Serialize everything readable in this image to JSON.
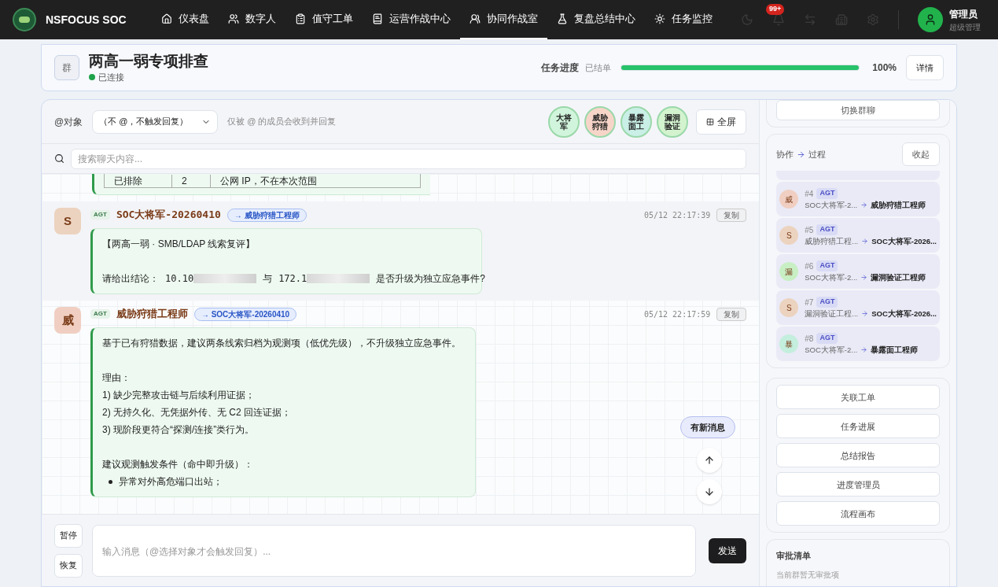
{
  "brand": "NSFOCUS SOC",
  "nav": [
    {
      "label": "仪表盘",
      "selected": false
    },
    {
      "label": "数字人",
      "selected": false
    },
    {
      "label": "值守工单",
      "selected": false
    },
    {
      "label": "运营作战中心",
      "selected": false
    },
    {
      "label": "协同作战室",
      "selected": true
    },
    {
      "label": "复盘总结中心",
      "selected": false
    },
    {
      "label": "任务监控",
      "selected": false
    }
  ],
  "notifications_badge": "99+",
  "user": {
    "name": "管理员",
    "role": "超级管理"
  },
  "room": {
    "avatar": "群",
    "title": "两高一弱专项排查",
    "status": "已连接",
    "connected": true,
    "progress_label": "任务进度",
    "progress_state": "已结单",
    "level": 1,
    "percent": "100%",
    "details_button": "详情"
  },
  "mention": {
    "label": "@对象",
    "value": "（不 @，不触发回复）",
    "hint": "仅被 @ 的成员会收到并回复"
  },
  "members": [
    {
      "label": "大将军",
      "color": "#d1f5dc"
    },
    {
      "label": "威胁狩猎",
      "color": "#f6d5c8"
    },
    {
      "label": "暴露面工",
      "color": "#c9efe6"
    },
    {
      "label": "漏洞验证",
      "color": "#d3f3cf"
    }
  ],
  "fullscreen_button": "全屏",
  "search": {
    "placeholder": "搜索聊天内容..."
  },
  "table_row": [
    "已排除",
    "2",
    "公网 IP，不在本次范围"
  ],
  "messages": [
    {
      "avatar": "S",
      "color": "#ecd3bf",
      "tag": "AGT",
      "sender": "SOC大将军-20260410",
      "target": "→ 威胁狩猎工程师",
      "time": "05/12 22:17:39",
      "copy": "复制",
      "lines": [
        {
          "kind": "text",
          "text": "【两高一弱 · SMB/LDAP 线索复评】"
        },
        {
          "kind": "gap"
        },
        {
          "kind": "mixed",
          "parts": [
            {
              "kind": "text",
              "text": "请给出结论："
            },
            {
              "kind": "code",
              "text": "10.10"
            },
            {
              "kind": "blur"
            },
            {
              "kind": "text",
              "text": "与"
            },
            {
              "kind": "code",
              "text": "172.1"
            },
            {
              "kind": "blur"
            },
            {
              "kind": "text",
              "text": "是否升级为独立应急事件?"
            }
          ]
        }
      ]
    },
    {
      "avatar": "威",
      "color": "#f0cfc2",
      "tag": "AGT",
      "sender": "威胁狩猎工程师",
      "target": "→ SOC大将军-20260410",
      "time": "05/12 22:17:59",
      "copy": "复制",
      "lines": [
        {
          "kind": "text",
          "text": "基于已有狩猎数据，建议两条线索归档为观测项（低优先级），不升级独立应急事件。"
        },
        {
          "kind": "gap"
        },
        {
          "kind": "text",
          "text": "理由："
        },
        {
          "kind": "text",
          "text": "1) 缺少完整攻击链与后续利用证据；"
        },
        {
          "kind": "text",
          "text": "2) 无持久化、无凭据外传、无 C2 回连证据；"
        },
        {
          "kind": "text",
          "text": "3) 现阶段更符合“探测/连接”类行为。"
        },
        {
          "kind": "gap"
        },
        {
          "kind": "text",
          "text": "建议观测触发条件（命中即升级）："
        },
        {
          "kind": "bullet",
          "text": "异常对外高危端口出站；"
        }
      ]
    }
  ],
  "new_message_button": "有新消息",
  "composer": {
    "pause": "暂停",
    "resume": "恢复",
    "placeholder": "输入消息（@选择对象才会触发回复）...",
    "send": "发送"
  },
  "sidebar": {
    "switch_button": "切换群聊",
    "flow_title_a": "协作",
    "flow_title_b": "过程",
    "collapse_button": "收起",
    "flow": [
      {
        "avatar": "威",
        "color": "#f0cfc2",
        "num": "#4",
        "tag": "AGT",
        "from": "SOC大将军-2...",
        "to": "威胁狩猎工程师"
      },
      {
        "avatar": "S",
        "color": "#ecd3bf",
        "num": "#5",
        "tag": "AGT",
        "from": "威胁狩猎工程...",
        "to": "SOC大将军-2026..."
      },
      {
        "avatar": "漏",
        "color": "#c8efc4",
        "num": "#6",
        "tag": "AGT",
        "from": "SOC大将军-2...",
        "to": "漏洞验证工程师"
      },
      {
        "avatar": "S",
        "color": "#ecd3bf",
        "num": "#7",
        "tag": "AGT",
        "from": "漏洞验证工程...",
        "to": "SOC大将军-2026..."
      },
      {
        "avatar": "暴",
        "color": "#c4eedd",
        "num": "#8",
        "tag": "AGT",
        "from": "SOC大将军-2...",
        "to": "暴露面工程师"
      }
    ],
    "actions": [
      "关联工单",
      "任务进展",
      "总结报告",
      "进度管理员",
      "流程画布"
    ],
    "approval_title": "审批清单",
    "approval_empty": "当前群暂无审批项"
  }
}
